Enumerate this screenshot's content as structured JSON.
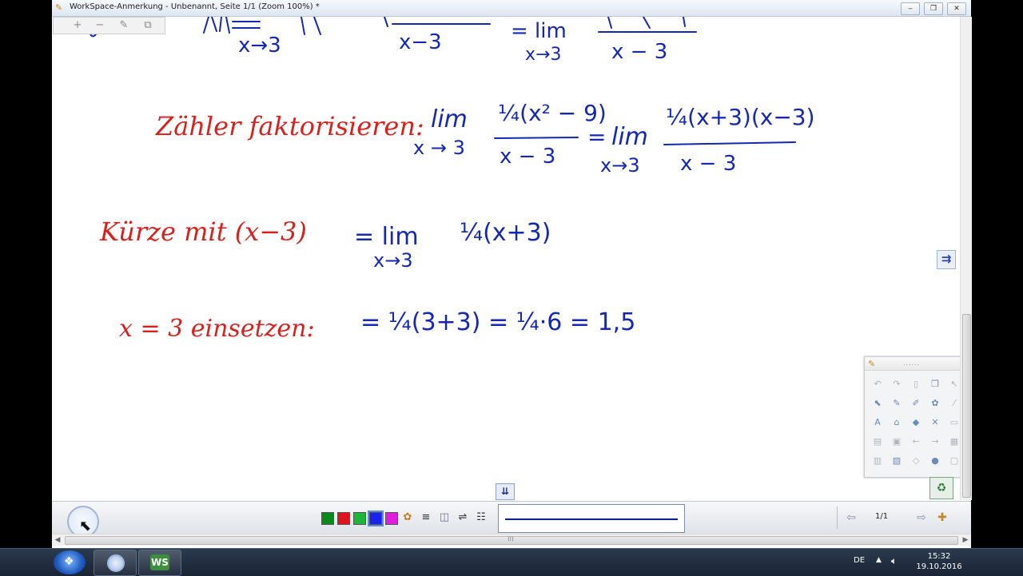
{
  "window": {
    "title": "WorkSpace-Anmerkung - Unbenannt, Seite 1/1  (Zoom 100%) *",
    "app_icon": "workspace-icon",
    "controls": {
      "minimize": "‒",
      "restore": "❐",
      "close": "✕"
    }
  },
  "mini_toolbar": {
    "zoom_in": "+",
    "zoom_out": "−",
    "edit": "✎",
    "windows": "⧉"
  },
  "canvas": {
    "ink_red": "#d8201c",
    "ink_blue": "#1428b4",
    "top_partial": {
      "lim_sub_1": "x→3",
      "denominator_1": "x−3",
      "equals_lim": "= lim",
      "lim_sub_2": "x→3",
      "denominator_2": "x − 3"
    },
    "step1": {
      "label": "Zähler faktorisieren:",
      "lim_word": "lim",
      "lim_sub": "x → 3",
      "frac_num": "¼(x² − 9)",
      "frac_den": "x − 3",
      "equals": "=",
      "lim_word_2": "lim",
      "lim_sub_2": "x→3",
      "frac_num_2": "¼(x+3)(x−3)",
      "frac_den_2": "x − 3"
    },
    "step2": {
      "label": "Kürze mit (x−3)",
      "equals_lim": "= lim",
      "lim_sub": "x→3",
      "expr": "¼(x+3)"
    },
    "step3": {
      "label": "x = 3 einsetzen:",
      "expr": "= ¼(3+3) = ¼·6 = 1,5"
    }
  },
  "side_button": {
    "icon": "double-arrow-right-icon",
    "glyph": "⇉"
  },
  "float_panel": {
    "grip": "......"
  },
  "bottombar": {
    "colors": [
      "#0a8a1a",
      "#e0141c",
      "#1db53a",
      "#1a22f0",
      "#e21be0"
    ],
    "selected_color": "#1a22f0",
    "pen_color": "#0019d6",
    "page_indicator": "1/1",
    "down_arrows": "⇊"
  },
  "taskbar": {
    "language": "DE",
    "time": "15:32",
    "date": "19.10.2016",
    "ws_label": "WS"
  }
}
